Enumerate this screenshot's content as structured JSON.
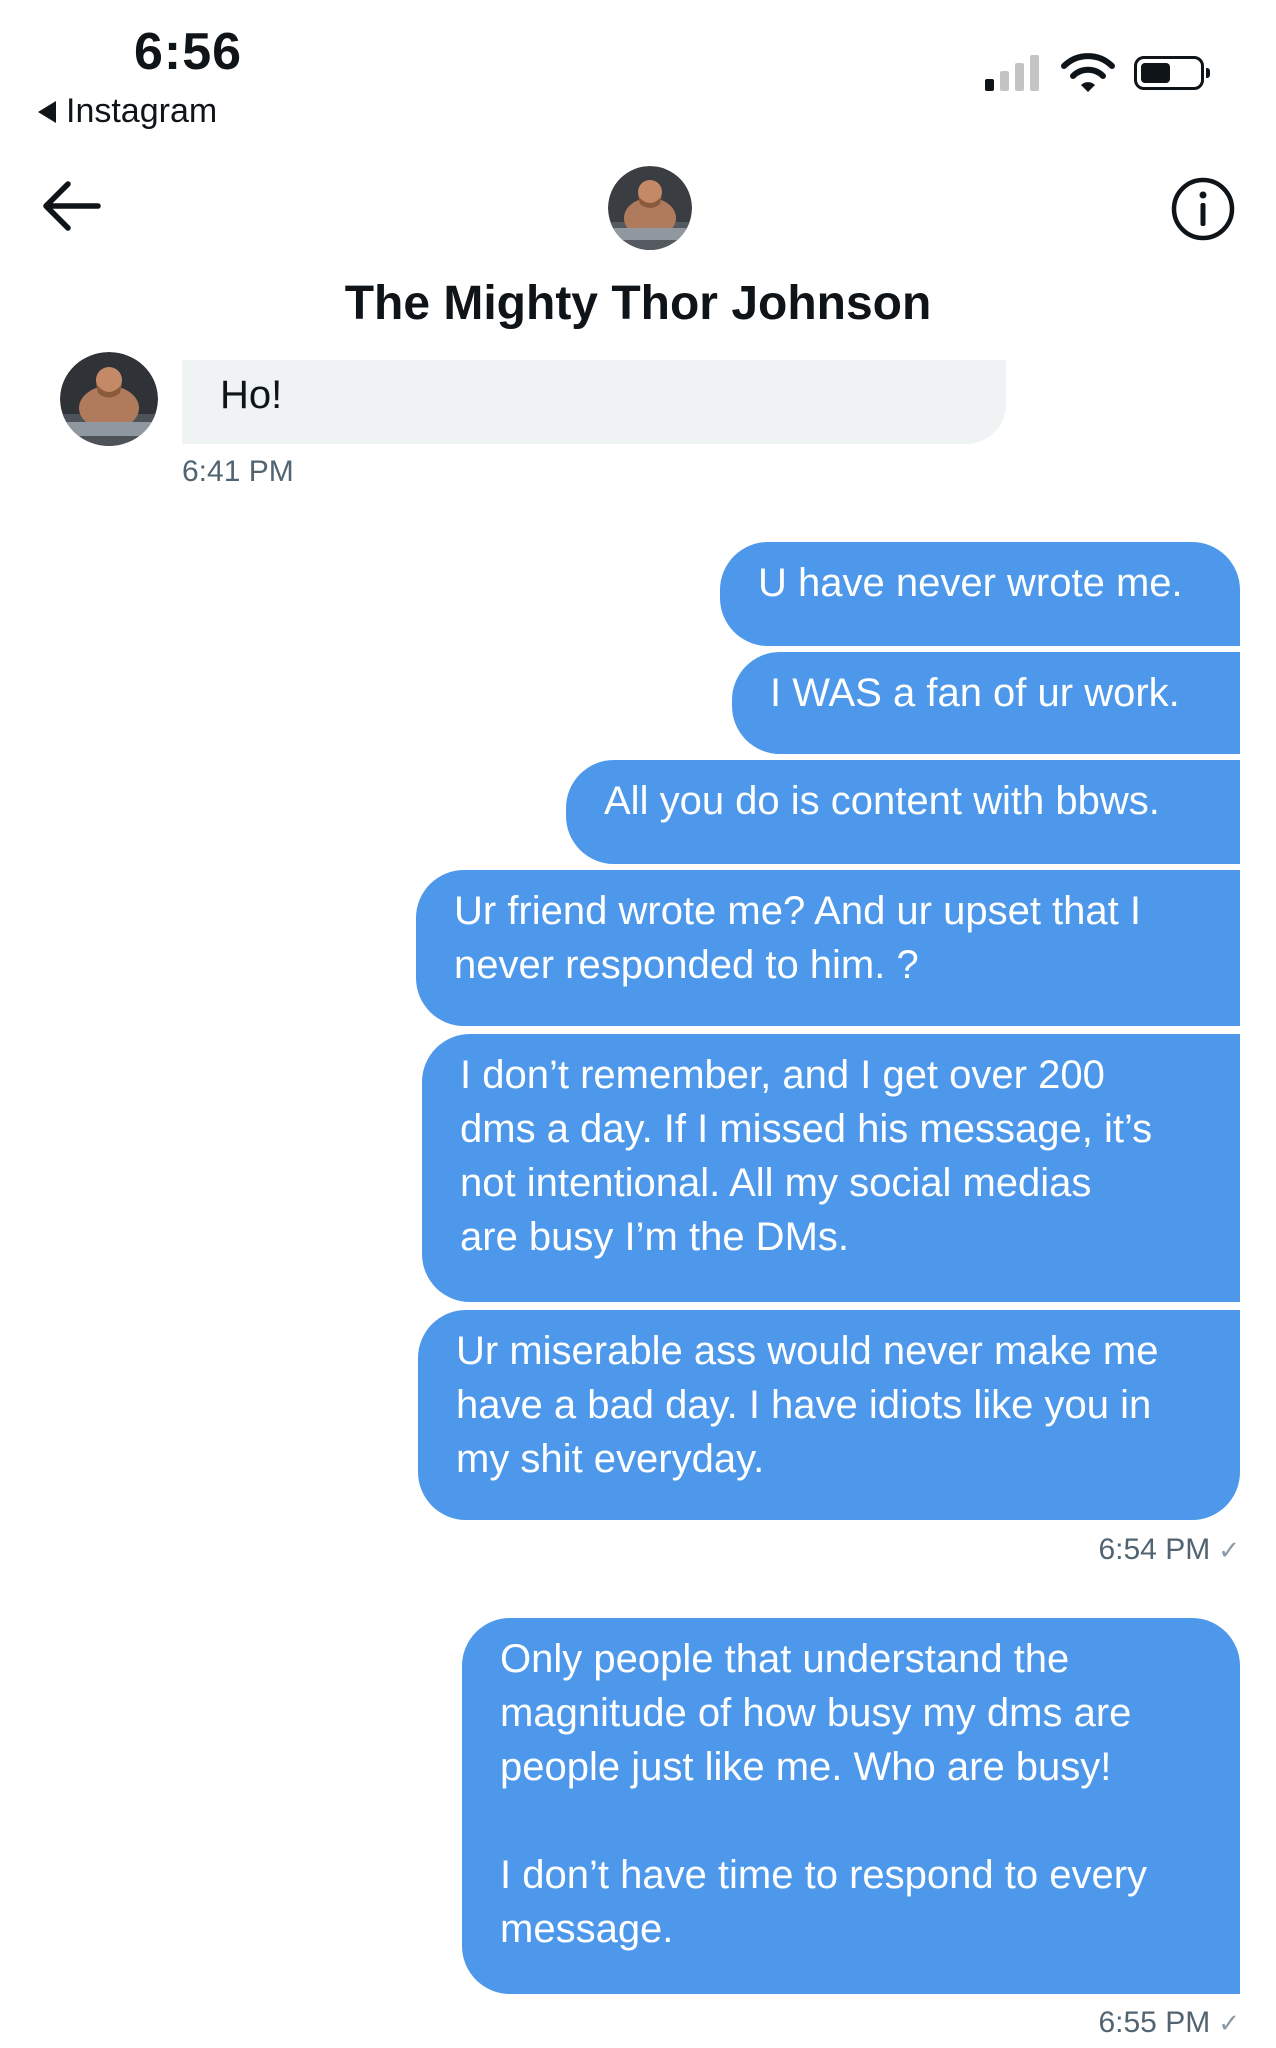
{
  "status_bar": {
    "time": "6:56",
    "back_app": "Instagram"
  },
  "header": {
    "contact_name": "The Mighty Thor Johnson"
  },
  "conversation": {
    "incoming": [
      {
        "text": "Ho!",
        "time": "6:41 PM"
      }
    ],
    "outgoing_group_1": {
      "messages": [
        "U have never wrote me.",
        "I WAS a fan of ur work.",
        "All you do is content with bbws.",
        "Ur friend wrote me? And ur upset that I\nnever responded to him. ?",
        "I don’t remember, and I get over 200\ndms a day. If I missed his message, it’s\nnot intentional. All my social medias\nare busy I’m the DMs.",
        "Ur miserable ass would never make me\nhave a bad day. I have idiots like you in\nmy shit everyday."
      ],
      "time": "6:54 PM"
    },
    "outgoing_group_2": {
      "messages": [
        "Only people that understand the\nmagnitude of how busy my dms are\npeople just like me. Who are busy!\n\nI don’t have time to respond to every\nmessage."
      ],
      "time": "6:55 PM"
    }
  }
}
